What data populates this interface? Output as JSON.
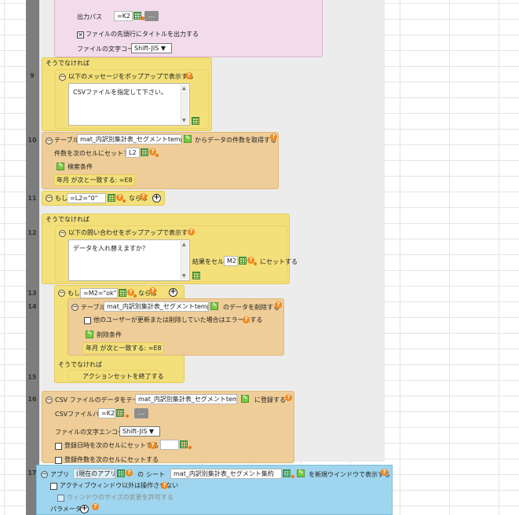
{
  "rows": [
    "9",
    "10",
    "11",
    "12",
    "13",
    "14",
    "15",
    "16",
    "17"
  ],
  "row0": {
    "output_path_label": "出力パス",
    "output_path_value": "=K2",
    "title_checkbox_label": "ファイルの先頭行にタイトルを出力する",
    "encoding_label": "ファイルの文字コード",
    "encoding_value": "Shift-JIS"
  },
  "else_label": "そうでなければ",
  "row9": {
    "title": "以下のメッセージをポップアップで表示する",
    "message": "CSVファイルを指定して下さい。"
  },
  "row10": {
    "table_label": "テーブル",
    "table_value": "mat_内訳別集計表_セグメントtemp",
    "after_label": "からデータの件数を取得する",
    "count_label": "件数を次のセルにセットする",
    "count_value": "L2",
    "search_label": "検索条件",
    "condition": "年月  が次と一致する:  =E8"
  },
  "row11": {
    "if_label": "もし",
    "if_value": "=L2=\"0\"",
    "then_label": "ならば"
  },
  "row12": {
    "title": "以下の問い合わせをポップアップで表示する",
    "message": "データを入れ替えますか？",
    "result_label": "結果をセル",
    "result_value": "M2",
    "set_label": "にセットする"
  },
  "row13": {
    "if_label": "もし",
    "if_value": "=M2=\"ok\"",
    "then_label": "ならば"
  },
  "row14": {
    "table_label": "テーブル",
    "table_value": "mat_内訳別集計表_セグメントtemp",
    "after_label": "のデータを削除する",
    "error_label": "他のユーザーが更新または削除していた場合はエラーとする",
    "delete_label": "削除条件",
    "condition": "年月  が次と一致する:  =E8"
  },
  "row15": {
    "label": "アクションセットを終了する"
  },
  "row16": {
    "title": "CSV ファイルのデータをテーブル",
    "table_value": "mat_内訳別集計表_セグメントtemp",
    "after_label": "に登録する",
    "csv_path_label": "CSVファイルパス",
    "csv_path_value": "=K2",
    "encoding_label": "ファイルの文字エンコード",
    "encoding_value": "Shift-JIS",
    "reg_datetime_label": "登録日時を次のセルにセットする",
    "reg_count_label": "登録件数を次のセルにセットする"
  },
  "row17": {
    "app_label": "アプリ",
    "app_value": "(現在のアプリ)",
    "of_label": "の",
    "sheet_label": "シート",
    "sheet_value": "mat_内訳別集計表_セグメント集約",
    "after_label": "を新規ウインドウで表示する",
    "active_label": "アクティブウィンドウ以外は操作させない",
    "window_label": "ウィンドウのサイズの変更を許可する",
    "params_label": "パラメータ"
  },
  "colors": {
    "yellow": "#f3e07a",
    "orange": "#efcd98",
    "pink": "#f2dcec",
    "blue": "#9fd5ee",
    "sidebar": "#7d7d7d"
  }
}
